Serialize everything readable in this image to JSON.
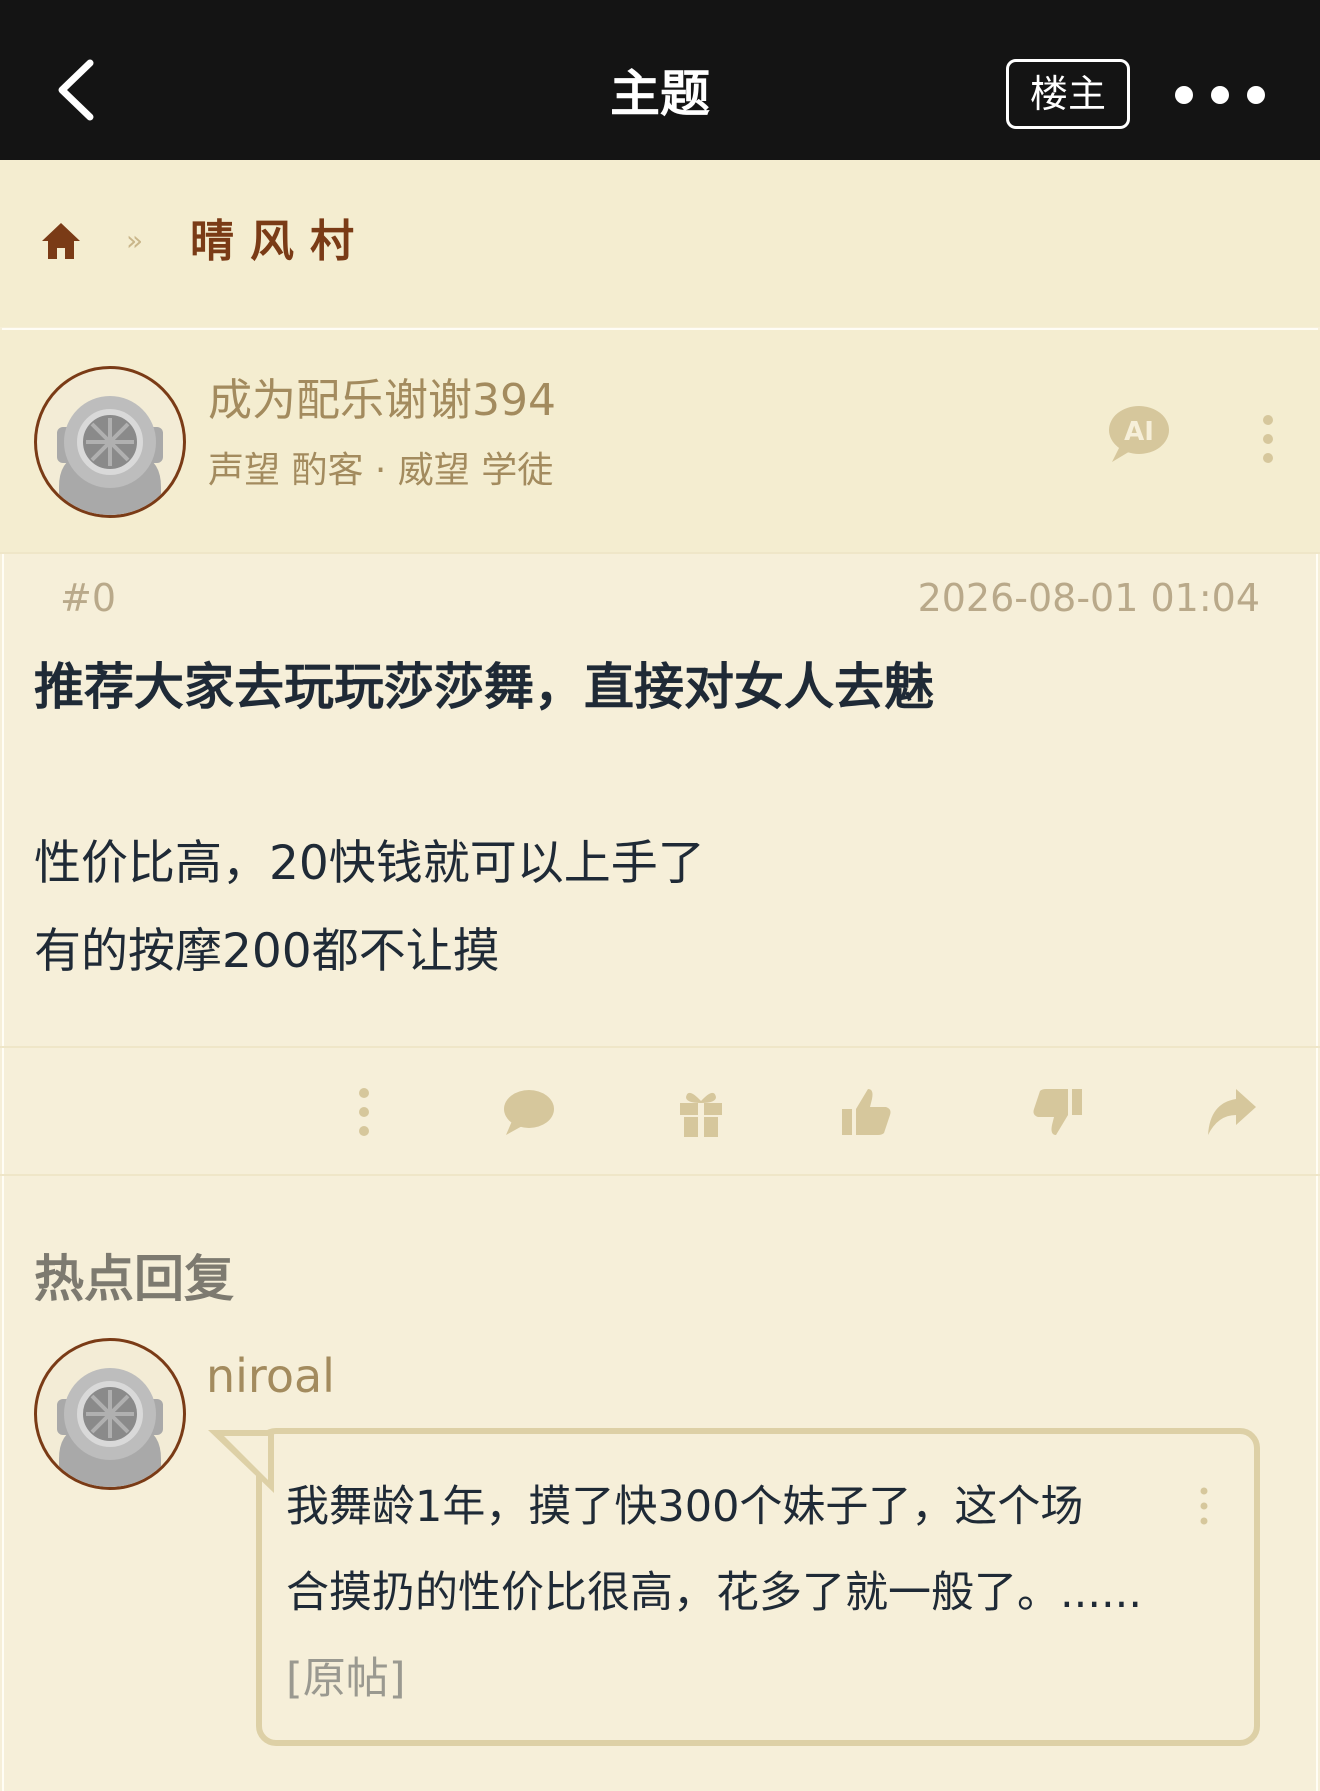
{
  "header": {
    "title": "主题",
    "op_button": "楼主"
  },
  "breadcrumb": {
    "separator": "»",
    "forum": "晴风村"
  },
  "post": {
    "author": "成为配乐谢谢394",
    "author_meta": "声望 酌客 · 威望 学徒",
    "ai_badge": "AI",
    "floor": "#0",
    "time": "2026-08-01 01:04",
    "title": "推荐大家去玩玩莎莎舞，直接对女人去魅",
    "body_lines": [
      "性价比高，20快钱就可以上手了",
      "有的按摩200都不让摸"
    ]
  },
  "actions": [
    "more",
    "comment",
    "gift",
    "upvote",
    "downvote",
    "share"
  ],
  "hot_replies": {
    "heading": "热点回复",
    "items": [
      {
        "user": "niroal",
        "lines": [
          "我舞龄1年，摸了快300个妹子了，这个场",
          "合摸扔的性价比很高，花多了就一般了。......"
        ],
        "link": "[原帖]"
      }
    ]
  },
  "colors": {
    "topbar": "#141414",
    "background": "#f6efd9",
    "accent": "#7a3b16",
    "muted": "#a38b5e",
    "icon": "#d6c79c"
  }
}
